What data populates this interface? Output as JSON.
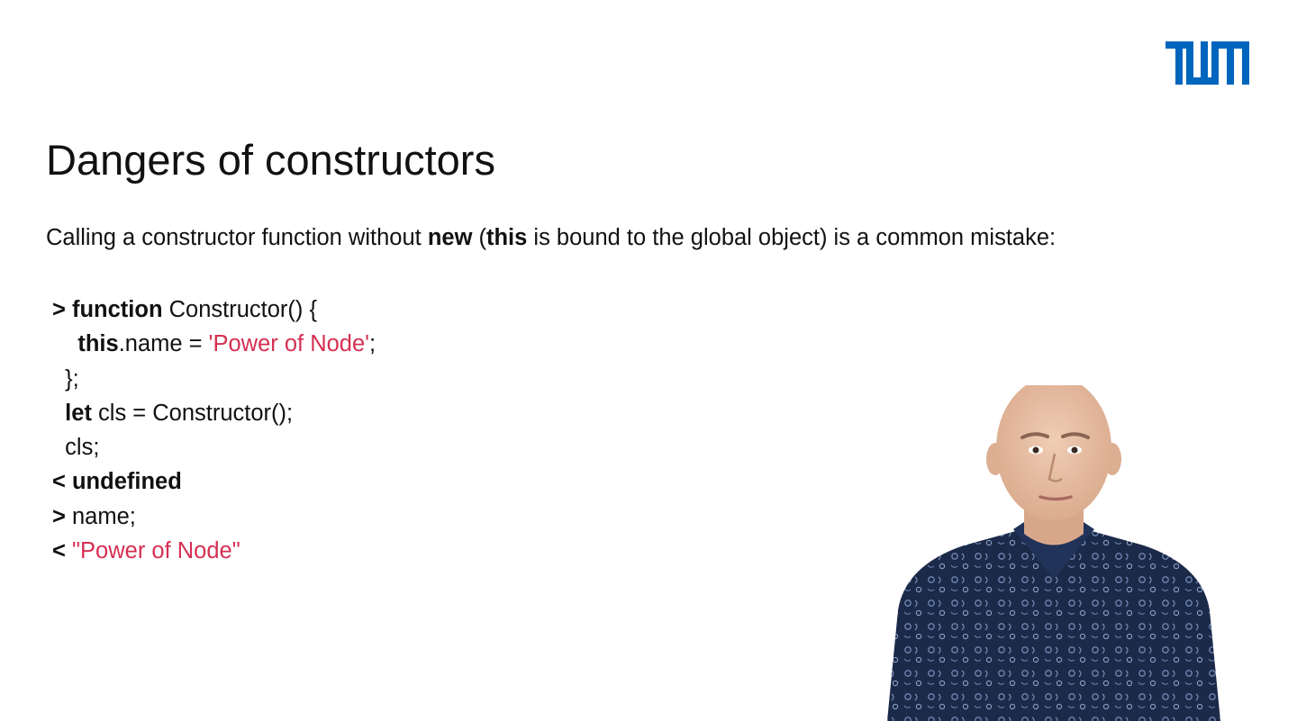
{
  "logo": {
    "text": "TUM",
    "color": "#0065bd"
  },
  "slide": {
    "title": "Dangers of constructors",
    "intro": {
      "part1": "Calling a constructor function without ",
      "kw_new": "new",
      "part2": " (",
      "kw_this": "this",
      "part3": " is bound to the global object) is a common mistake:"
    },
    "code": {
      "l1_prompt": "> ",
      "l1_kw": "function",
      "l1_rest": " Constructor() {",
      "l2_indent": "    ",
      "l2_kw": "this",
      "l2_mid": ".name = ",
      "l2_str": "'Power of Node'",
      "l2_end": ";",
      "l3": "  };",
      "l4_indent": "  ",
      "l4_kw": "let",
      "l4_rest": " cls = Constructor();",
      "l5": "  cls;",
      "l6": "< undefined",
      "l7_prompt": "> ",
      "l7_rest": "name;",
      "l8_prompt": "< ",
      "l8_str": "\"Power of Node\""
    }
  },
  "colors": {
    "string": "#d62f52",
    "text": "#111111",
    "shirt": "#1c2a4a",
    "skin": "#e7c1a6"
  }
}
